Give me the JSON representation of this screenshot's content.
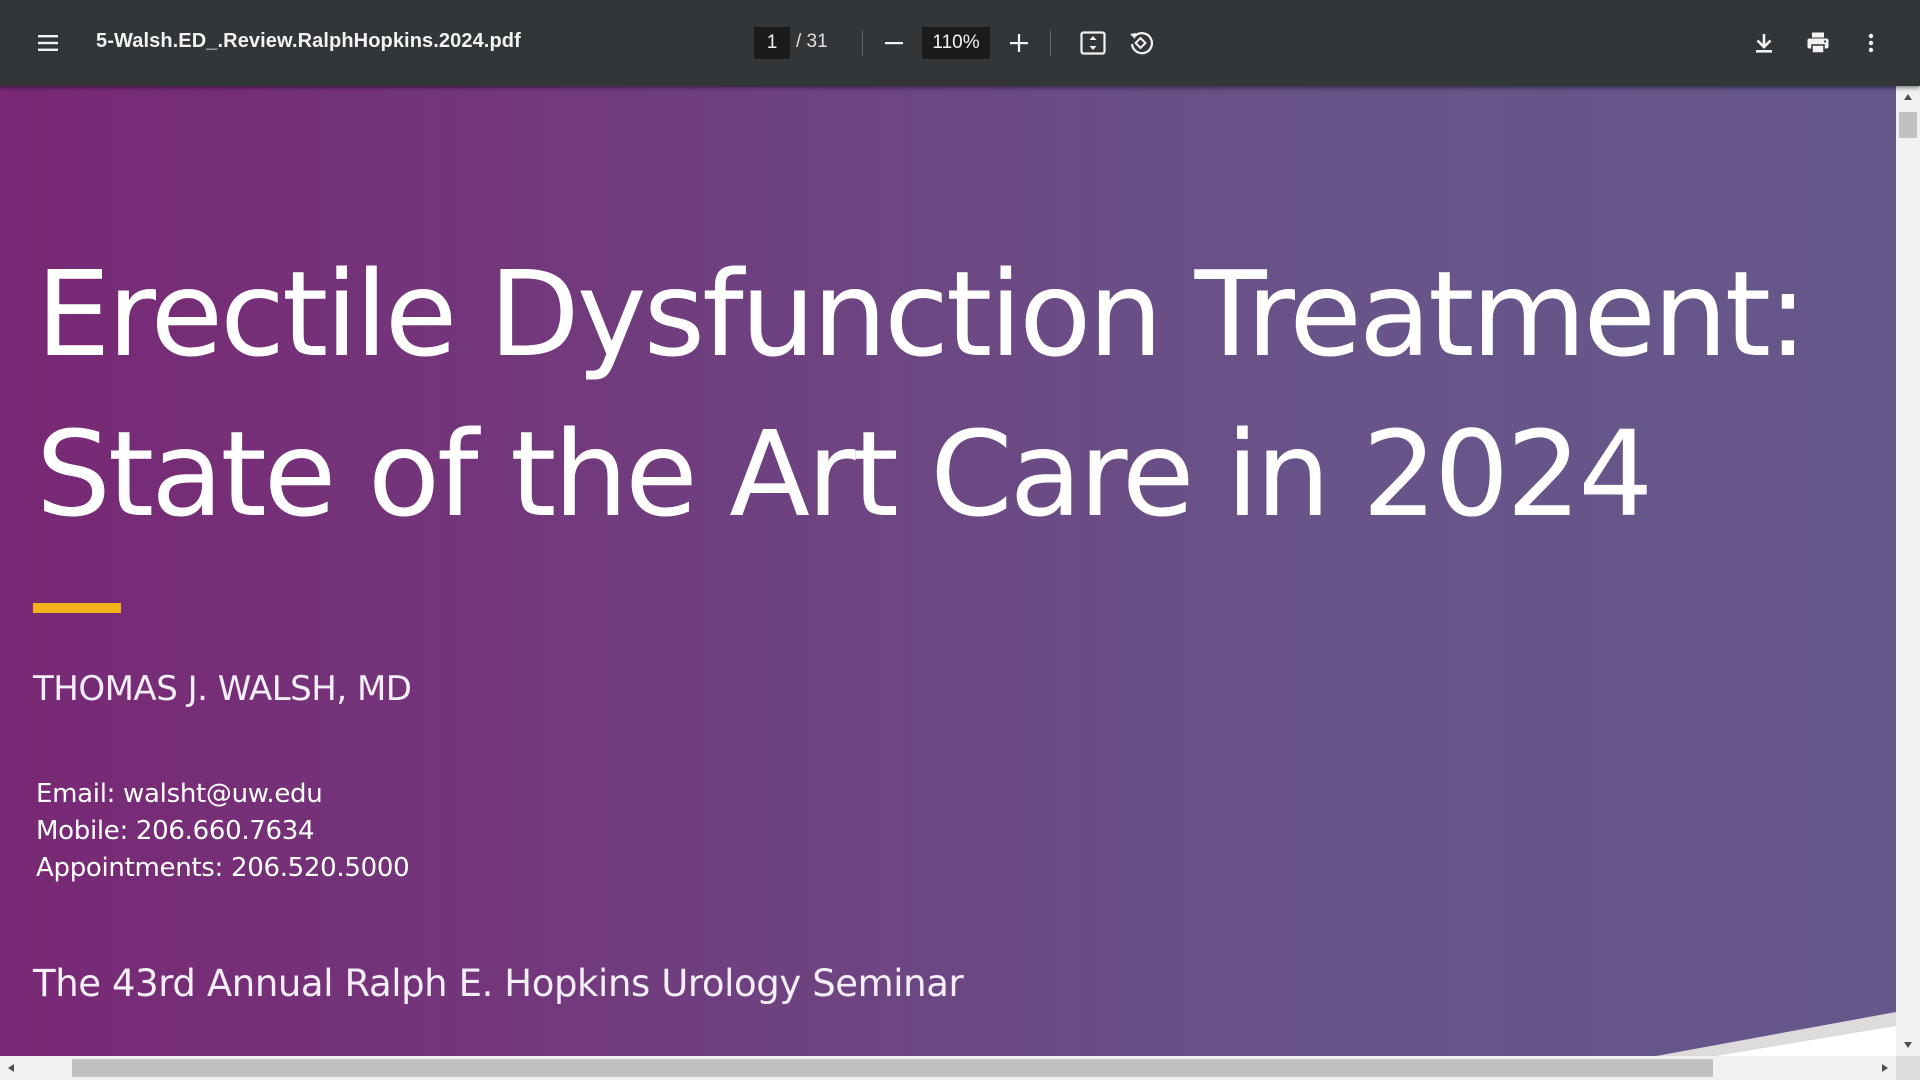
{
  "toolbar": {
    "file_name": "5-Walsh.ED_.Review.RalphHopkins.2024.pdf",
    "current_page": "1",
    "page_total": "/ 31",
    "zoom": "110%",
    "icons": {
      "menu": "menu-icon",
      "zoom_out": "minus-icon",
      "zoom_in": "plus-icon",
      "fit": "fit-to-page-icon",
      "rotate": "rotate-counterclockwise-icon",
      "download": "download-icon",
      "print": "print-icon",
      "more": "more-vertical-icon"
    }
  },
  "slide": {
    "title_line1": "Erectile Dysfunction Treatment:",
    "title_line2": "State of the Art Care in 2024",
    "author": "THOMAS J. WALSH, MD",
    "contact": {
      "email": "Email: walsht@uw.edu",
      "mobile": "Mobile: 206.660.7634",
      "appointments": "Appointments: 206.520.5000"
    },
    "seminar": "The 43rd Annual Ralph E. Hopkins Urology Seminar",
    "colors": {
      "gradient_start": "#782874",
      "gradient_end": "#66578b",
      "accent": "#f2b21b"
    }
  },
  "colors": {
    "toolbar_bg": "#323639",
    "toolbar_text": "#f1f3f4",
    "input_bg": "#191b1c"
  }
}
